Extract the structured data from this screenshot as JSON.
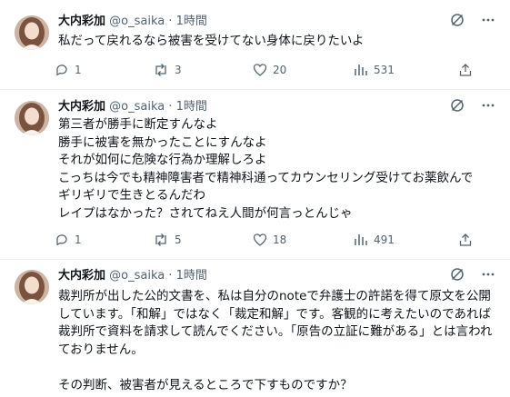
{
  "tweets": [
    {
      "name": "大内彩加",
      "handle": "@o_saika",
      "sep": "·",
      "time": "1時間",
      "text": "私だって戻れるなら被害を受けてない身体に戻りたいよ",
      "replies": "1",
      "retweets": "3",
      "likes": "20",
      "views": "531"
    },
    {
      "name": "大内彩加",
      "handle": "@o_saika",
      "sep": "·",
      "time": "1時間",
      "text": "第三者が勝手に断定すんなよ\n勝手に被害を無かったことにすんなよ\nそれが如何に危険な行為か理解しろよ\nこっちは今でも精神障害者で精神科通ってカウンセリング受けてお薬飲んで\nギリギリで生きとるんだわ\nレイプはなかった？されてねえ人間が何言っとんじゃ",
      "replies": "1",
      "retweets": "5",
      "likes": "18",
      "views": "491"
    },
    {
      "name": "大内彩加",
      "handle": "@o_saika",
      "sep": "·",
      "time": "1時間",
      "text": "裁判所が出した公的文書を、私は自分のnoteで弁護士の許諾を得て原文を公開しています。「和解」ではなく「裁定和解」です。客観的に考えたいのであれば裁判所で資料を請求して読んでください。「原告の立証に難がある」とは言われておりません。\n\nその判断、被害者が見えるところで下すものですか？"
    }
  ],
  "colors": {
    "text": "#0f1419",
    "secondary": "#536471",
    "divider": "#eff3f4"
  },
  "icons": [
    "grok-icon",
    "more-icon",
    "reply-icon",
    "retweet-icon",
    "like-icon",
    "views-icon",
    "share-icon"
  ]
}
